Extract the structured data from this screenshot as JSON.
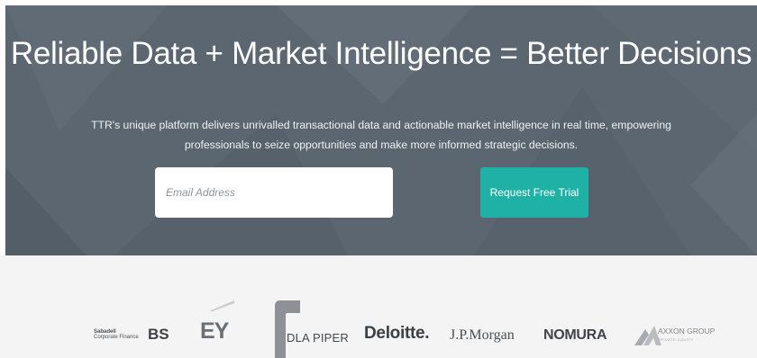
{
  "hero": {
    "title": "Reliable Data + Market Intelligence = Better Decisions",
    "subtitle": "TTR's unique platform delivers unrivalled transactional data and actionable market intelligence in real time, empowering professionals to seize opportunities and make more informed strategic decisions.",
    "email_placeholder": "Email Address",
    "cta_label": "Request Free Trial"
  },
  "colors": {
    "hero_background": "#5c6670",
    "cta_background": "#1fb1a5",
    "logo_strip_background": "#f4f4f4"
  },
  "logos": {
    "sabadell_line1": "Sabadell",
    "sabadell_line2": "Corporate Finance",
    "bs": "BS",
    "ey": "EY",
    "dla_piper": "DLA PIPER",
    "deloitte": "Deloitte.",
    "jp_morgan": "J.P.Morgan",
    "nomura": "NOMURA",
    "axxon": "AXXON GROUP",
    "axxon_sub": "PRIVATE EQUITY"
  }
}
